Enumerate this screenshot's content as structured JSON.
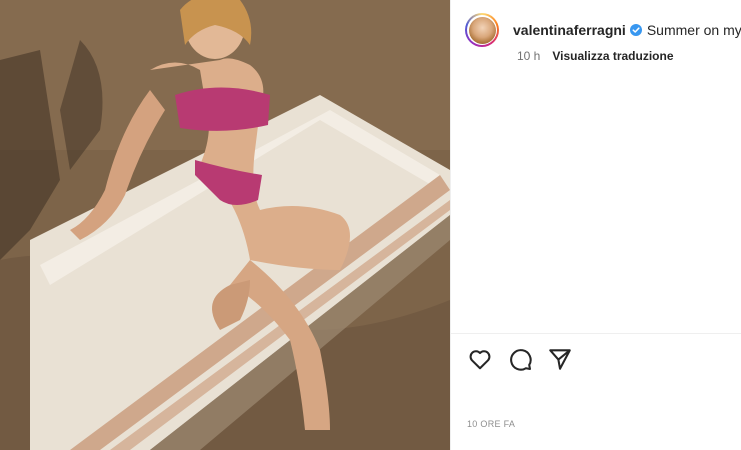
{
  "post": {
    "username": "valentinaferragni",
    "caption": "Summer on my s",
    "time_ago": "10 h",
    "translate_label": "Visualizza traduzione",
    "timestamp": "10 ORE FA"
  },
  "icons": {
    "verified": "verified-badge-icon",
    "like": "heart-icon",
    "comment": "comment-icon",
    "share": "share-icon"
  },
  "colors": {
    "verified": "#3897f0",
    "text": "#262626",
    "muted": "#737373"
  }
}
